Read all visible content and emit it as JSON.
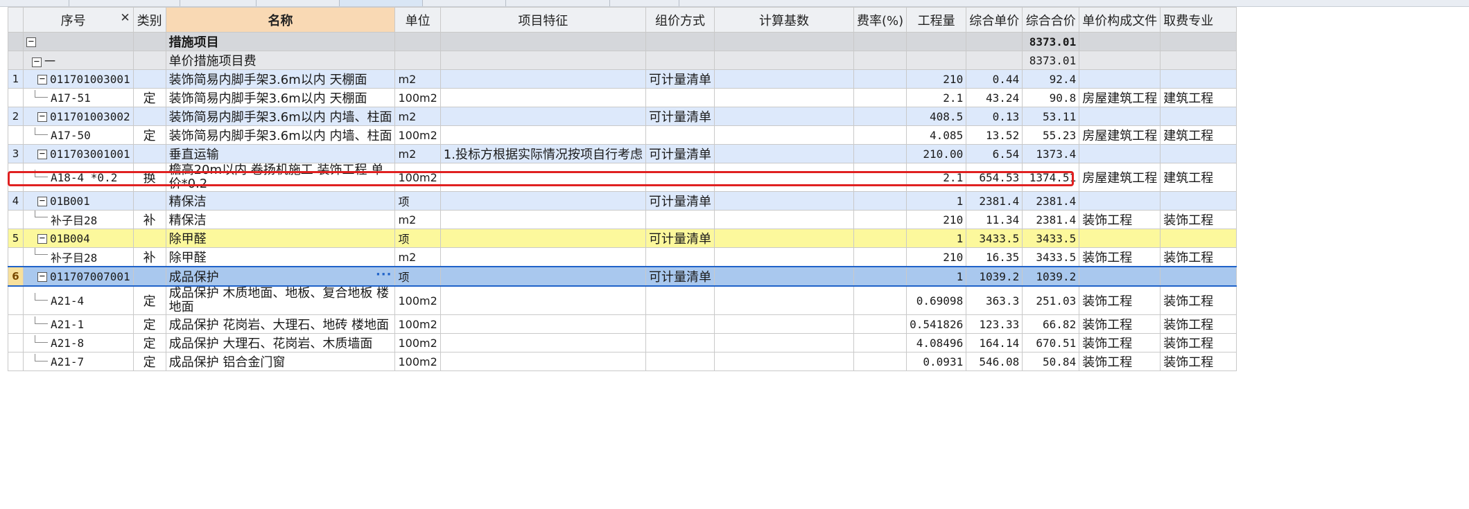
{
  "tabs": [
    "",
    "",
    "",
    "",
    "",
    "",
    "",
    "",
    "",
    "",
    ""
  ],
  "columns": {
    "seq": "序号",
    "kind": "类别",
    "name": "名称",
    "unit": "单位",
    "feature": "项目特征",
    "method": "组价方式",
    "base": "计算基数",
    "rate": "费率(%)",
    "qty": "工程量",
    "unit_price": "综合单价",
    "total_price": "综合合价",
    "doc": "单价构成文件",
    "major": "取费专业"
  },
  "rows": [
    {
      "type": "section",
      "sn": "",
      "code": "",
      "kind": "",
      "name": "措施项目",
      "unit": "",
      "feature": "",
      "method": "",
      "qty": "",
      "unit_price": "",
      "total": "8373.01",
      "doc": "",
      "major": ""
    },
    {
      "type": "subsection",
      "sn": "",
      "code": "一",
      "kind": "",
      "name": "单价措施项目费",
      "unit": "",
      "feature": "",
      "method": "",
      "qty": "",
      "unit_price": "",
      "total": "8373.01",
      "doc": "",
      "major": ""
    },
    {
      "type": "list",
      "sn": "1",
      "code": "011701003001",
      "kind": "",
      "name": "装饰简易内脚手架3.6m以内 天棚面",
      "unit": "m2",
      "feature": "",
      "method": "可计量清单",
      "qty": "210",
      "unit_price": "0.44",
      "total": "92.4",
      "doc": "",
      "major": ""
    },
    {
      "type": "quota",
      "sn": "",
      "code": "A17-51",
      "kind": "定",
      "name": "装饰简易内脚手架3.6m以内 天棚面",
      "unit": "100m2",
      "feature": "",
      "method": "",
      "qty": "2.1",
      "unit_price": "43.24",
      "total": "90.8",
      "doc": "房屋建筑工程",
      "major": "建筑工程"
    },
    {
      "type": "list",
      "sn": "2",
      "code": "011701003002",
      "kind": "",
      "name": "装饰简易内脚手架3.6m以内 内墙、柱面",
      "unit": "m2",
      "feature": "",
      "method": "可计量清单",
      "qty": "408.5",
      "unit_price": "0.13",
      "total": "53.11",
      "doc": "",
      "major": ""
    },
    {
      "type": "quota",
      "sn": "",
      "code": "A17-50",
      "kind": "定",
      "name": "装饰简易内脚手架3.6m以内 内墙、柱面",
      "unit": "100m2",
      "feature": "",
      "method": "",
      "qty": "4.085",
      "unit_price": "13.52",
      "total": "55.23",
      "doc": "房屋建筑工程",
      "major": "建筑工程"
    },
    {
      "type": "list",
      "sn": "3",
      "code": "011703001001",
      "kind": "",
      "name": "垂直运输",
      "unit": "m2",
      "feature": "1.投标方根据实际情况按项自行考虑",
      "method": "可计量清单",
      "qty": "210.00",
      "unit_price": "6.54",
      "total": "1373.4",
      "doc": "",
      "major": ""
    },
    {
      "type": "quota-tall",
      "sn": "",
      "code": "A18-4 *0.2",
      "kind": "换",
      "name": "檐高20m以内 卷扬机施工  装饰工程 单价*0.2",
      "unit": "100m2",
      "feature": "",
      "method": "",
      "qty": "2.1",
      "unit_price": "654.53",
      "total": "1374.51",
      "doc": "房屋建筑工程",
      "major": "建筑工程"
    },
    {
      "type": "list",
      "sn": "4",
      "code": "01B001",
      "kind": "",
      "name": "精保洁",
      "unit": "项",
      "feature": "",
      "method": "可计量清单",
      "qty": "1",
      "unit_price": "2381.4",
      "total": "2381.4",
      "doc": "",
      "major": ""
    },
    {
      "type": "quota",
      "sn": "",
      "code": "补子目28",
      "kind": "补",
      "name": "精保洁",
      "unit": "m2",
      "feature": "",
      "method": "",
      "qty": "210",
      "unit_price": "11.34",
      "total": "2381.4",
      "doc": "装饰工程",
      "major": "装饰工程"
    },
    {
      "type": "list-yellow",
      "sn": "5",
      "code": "01B004",
      "kind": "",
      "name": "除甲醛",
      "unit": "项",
      "feature": "",
      "method": "可计量清单",
      "qty": "1",
      "unit_price": "3433.5",
      "total": "3433.5",
      "doc": "",
      "major": ""
    },
    {
      "type": "quota",
      "sn": "",
      "code": "补子目28",
      "kind": "补",
      "name": "除甲醛",
      "unit": "m2",
      "feature": "",
      "method": "",
      "qty": "210",
      "unit_price": "16.35",
      "total": "3433.5",
      "doc": "装饰工程",
      "major": "装饰工程"
    },
    {
      "type": "selected",
      "sn": "6",
      "code": "011707007001",
      "kind": "",
      "name": "成品保护",
      "unit": "项",
      "feature": "",
      "method": "可计量清单",
      "qty": "1",
      "unit_price": "1039.2",
      "total": "1039.2",
      "doc": "",
      "major": ""
    },
    {
      "type": "quota-tall",
      "sn": "",
      "code": "A21-4",
      "kind": "定",
      "name": "成品保护 木质地面、地板、复合地板 楼地面",
      "unit": "100m2",
      "feature": "",
      "method": "",
      "qty": "0.69098",
      "unit_price": "363.3",
      "total": "251.03",
      "doc": "装饰工程",
      "major": "装饰工程"
    },
    {
      "type": "quota",
      "sn": "",
      "code": "A21-1",
      "kind": "定",
      "name": "成品保护 花岗岩、大理石、地砖 楼地面",
      "unit": "100m2",
      "feature": "",
      "method": "",
      "qty": "0.541826",
      "unit_price": "123.33",
      "total": "66.82",
      "doc": "装饰工程",
      "major": "装饰工程"
    },
    {
      "type": "quota",
      "sn": "",
      "code": "A21-8",
      "kind": "定",
      "name": "成品保护 大理石、花岗岩、木质墙面",
      "unit": "100m2",
      "feature": "",
      "method": "",
      "qty": "4.08496",
      "unit_price": "164.14",
      "total": "670.51",
      "doc": "装饰工程",
      "major": "装饰工程"
    },
    {
      "type": "quota",
      "sn": "",
      "code": "A21-7",
      "kind": "定",
      "name": "成品保护 铝合金门窗",
      "unit": "100m2",
      "feature": "",
      "method": "",
      "qty": "0.0931",
      "unit_price": "546.08",
      "total": "50.84",
      "doc": "装饰工程",
      "major": "装饰工程"
    }
  ],
  "colors": {
    "highlight": "#e02020",
    "selected_border": "#1f62c8",
    "name_header": "#f9d9b4",
    "list_row": "#dde9fb",
    "yellow_row": "#fcf89c"
  }
}
